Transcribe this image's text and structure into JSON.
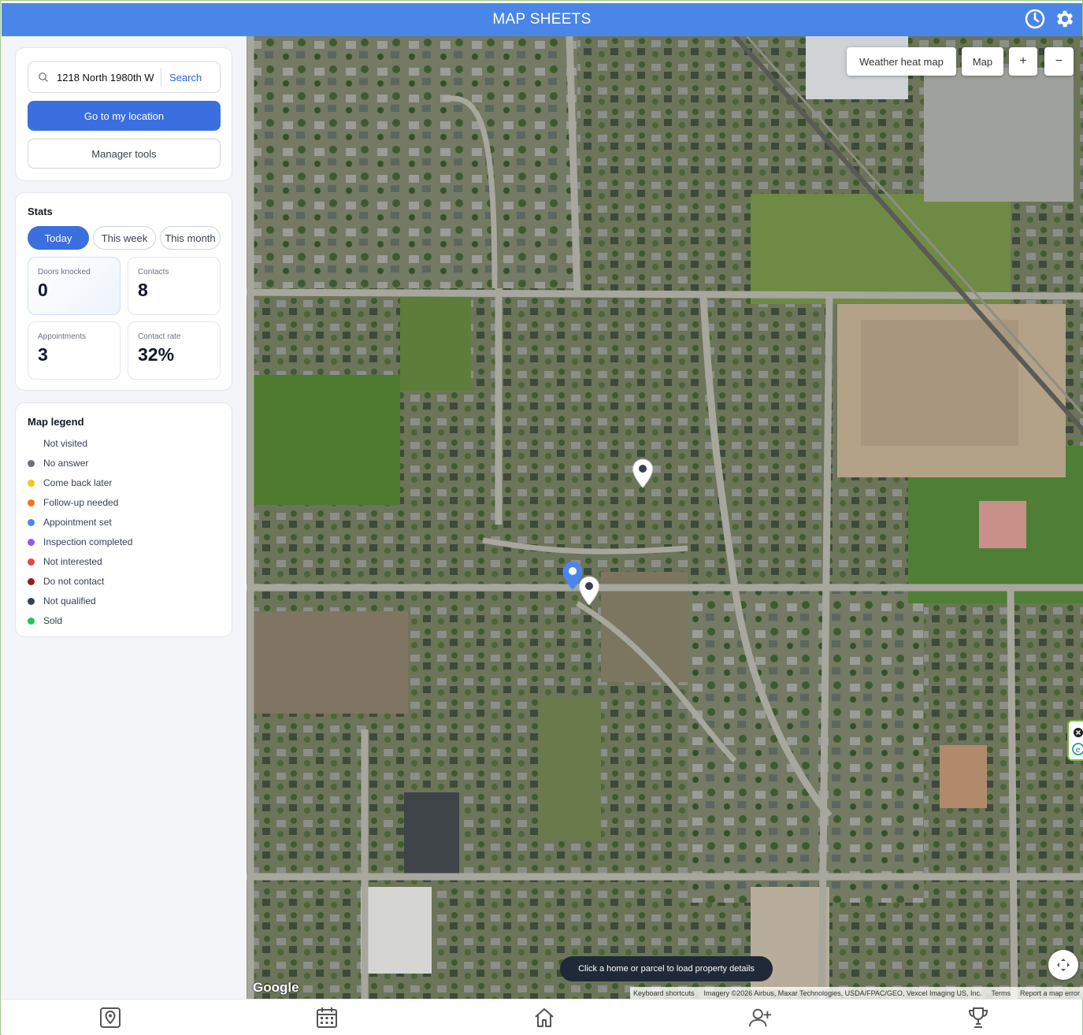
{
  "header": {
    "title": "MAP SHEETS",
    "icons": [
      "clock-icon",
      "gear-icon"
    ]
  },
  "search": {
    "value": "1218 North 1980th W",
    "button_label": "Search"
  },
  "actions": {
    "go_location_label": "Go to my location",
    "manager_tools_label": "Manager tools"
  },
  "stats": {
    "title": "Stats",
    "tabs": [
      {
        "label": "Today",
        "active": true
      },
      {
        "label": "This week",
        "active": false
      },
      {
        "label": "This month",
        "active": false
      }
    ],
    "items": [
      {
        "label": "Doors knocked",
        "value": "0"
      },
      {
        "label": "Contacts",
        "value": "8"
      },
      {
        "label": "Appointments",
        "value": "3"
      },
      {
        "label": "Contact rate",
        "value": "32%"
      }
    ]
  },
  "legend": {
    "title": "Map legend",
    "items": [
      {
        "label": "Not visited",
        "color": "#ffffff"
      },
      {
        "label": "No answer",
        "color": "#6b7280"
      },
      {
        "label": "Come back later",
        "color": "#f4c518"
      },
      {
        "label": "Follow-up needed",
        "color": "#f97316"
      },
      {
        "label": "Appointment set",
        "color": "#4a86e8"
      },
      {
        "label": "Inspection completed",
        "color": "#8b5cf6"
      },
      {
        "label": "Not interested",
        "color": "#ef4444"
      },
      {
        "label": "Do not contact",
        "color": "#991b1b"
      },
      {
        "label": "Not qualified",
        "color": "#374151"
      },
      {
        "label": "Sold",
        "color": "#22c55e"
      }
    ]
  },
  "map": {
    "controls": {
      "heatmap_label": "Weather heat map",
      "maptype_label": "Map",
      "zoom_in": "+",
      "zoom_out": "−"
    },
    "toast": "Click a home or parcel to load property details",
    "logo": "Google",
    "attribution": {
      "shortcuts": "Keyboard shortcuts",
      "imagery": "Imagery ©2026 Airbus, Maxar Technologies, USDA/FPAC/GEO, Vexcel Imaging US, Inc.",
      "terms": "Terms",
      "report": "Report a map error"
    }
  },
  "bottom_nav": [
    "map-pin-icon",
    "calendar-icon",
    "home-icon",
    "add-user-icon",
    "trophy-icon"
  ]
}
